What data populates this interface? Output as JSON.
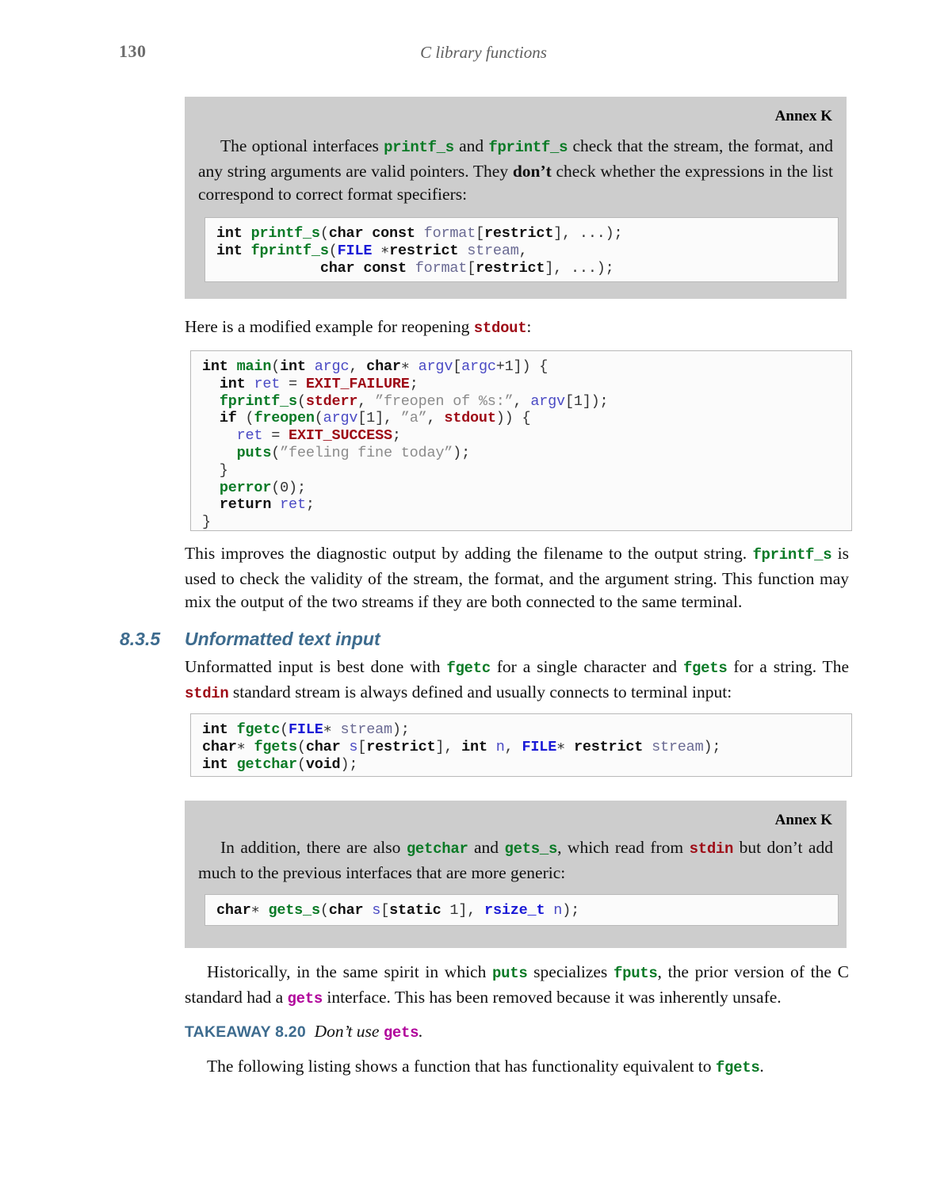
{
  "page": {
    "folio": "130",
    "running_title": "C library functions"
  },
  "annex1": {
    "label": "Annex K",
    "text_parts": [
      {
        "t": "The optional interfaces ",
        "s": "plain"
      },
      {
        "t": "printf_s",
        "s": "func"
      },
      {
        "t": " and ",
        "s": "plain"
      },
      {
        "t": "fprintf_s",
        "s": "func"
      },
      {
        "t": " check that the stream, the for­mat, and any string arguments are valid pointers. They ",
        "s": "plain"
      },
      {
        "t": "don’t",
        "s": "bold"
      },
      {
        "t": " check whether the expres­sions in the list correspond to correct format specifiers:",
        "s": "plain"
      }
    ],
    "code": [
      [
        {
          "t": "int ",
          "c": "kw"
        },
        {
          "t": "printf_s",
          "c": "fn"
        },
        {
          "t": "(",
          "c": "pun"
        },
        {
          "t": "char const",
          "c": "kw"
        },
        {
          "t": " ",
          "c": "pun"
        },
        {
          "t": "format",
          "c": "idg"
        },
        {
          "t": "[",
          "c": "pun"
        },
        {
          "t": "restrict",
          "c": "kw"
        },
        {
          "t": "], ...);",
          "c": "pun"
        }
      ],
      [
        {
          "t": "int ",
          "c": "kw"
        },
        {
          "t": "fprintf_s",
          "c": "fn"
        },
        {
          "t": "(",
          "c": "pun"
        },
        {
          "t": "FILE",
          "c": "ty"
        },
        {
          "t": " ∗",
          "c": "pun"
        },
        {
          "t": "restrict",
          "c": "kw"
        },
        {
          "t": " ",
          "c": "pun"
        },
        {
          "t": "stream",
          "c": "idg"
        },
        {
          "t": ",",
          "c": "pun"
        }
      ],
      [
        {
          "t": "            ",
          "c": "pun"
        },
        {
          "t": "char const",
          "c": "kw"
        },
        {
          "t": " ",
          "c": "pun"
        },
        {
          "t": "format",
          "c": "idg"
        },
        {
          "t": "[",
          "c": "pun"
        },
        {
          "t": "restrict",
          "c": "kw"
        },
        {
          "t": "], ...);",
          "c": "pun"
        }
      ]
    ]
  },
  "lead_in": {
    "parts": [
      {
        "t": "Here is a modified example for reopening ",
        "s": "plain"
      },
      {
        "t": "stdout",
        "s": "macro"
      },
      {
        "t": ":",
        "s": "plain"
      }
    ]
  },
  "main_listing": {
    "code": [
      [
        {
          "t": "int ",
          "c": "kw"
        },
        {
          "t": "main",
          "c": "fn"
        },
        {
          "t": "(",
          "c": "pun"
        },
        {
          "t": "int",
          "c": "kw"
        },
        {
          "t": " ",
          "c": "pun"
        },
        {
          "t": "argc",
          "c": "id"
        },
        {
          "t": ", ",
          "c": "pun"
        },
        {
          "t": "char",
          "c": "kw"
        },
        {
          "t": "∗ ",
          "c": "pun"
        },
        {
          "t": "argv",
          "c": "id"
        },
        {
          "t": "[",
          "c": "pun"
        },
        {
          "t": "argc",
          "c": "id"
        },
        {
          "t": "+1]) {",
          "c": "pun"
        }
      ],
      [
        {
          "t": "  ",
          "c": "pun"
        },
        {
          "t": "int",
          "c": "kw"
        },
        {
          "t": " ",
          "c": "pun"
        },
        {
          "t": "ret",
          "c": "id"
        },
        {
          "t": " = ",
          "c": "pun"
        },
        {
          "t": "EXIT_FAILURE",
          "c": "mac"
        },
        {
          "t": ";",
          "c": "pun"
        }
      ],
      [
        {
          "t": "  ",
          "c": "pun"
        },
        {
          "t": "fprintf_s",
          "c": "fn"
        },
        {
          "t": "(",
          "c": "pun"
        },
        {
          "t": "stderr",
          "c": "mac"
        },
        {
          "t": ", ",
          "c": "pun"
        },
        {
          "t": "”freopen of %s:”",
          "c": "str"
        },
        {
          "t": ", ",
          "c": "pun"
        },
        {
          "t": "argv",
          "c": "id"
        },
        {
          "t": "[1]);",
          "c": "pun"
        }
      ],
      [
        {
          "t": "  ",
          "c": "pun"
        },
        {
          "t": "if",
          "c": "kw"
        },
        {
          "t": " (",
          "c": "pun"
        },
        {
          "t": "freopen",
          "c": "fn"
        },
        {
          "t": "(",
          "c": "pun"
        },
        {
          "t": "argv",
          "c": "id"
        },
        {
          "t": "[1], ",
          "c": "pun"
        },
        {
          "t": "”a”",
          "c": "str"
        },
        {
          "t": ", ",
          "c": "pun"
        },
        {
          "t": "stdout",
          "c": "mac"
        },
        {
          "t": ")) {",
          "c": "pun"
        }
      ],
      [
        {
          "t": "    ",
          "c": "pun"
        },
        {
          "t": "ret",
          "c": "id"
        },
        {
          "t": " = ",
          "c": "pun"
        },
        {
          "t": "EXIT_SUCCESS",
          "c": "mac"
        },
        {
          "t": ";",
          "c": "pun"
        }
      ],
      [
        {
          "t": "    ",
          "c": "pun"
        },
        {
          "t": "puts",
          "c": "fn"
        },
        {
          "t": "(",
          "c": "pun"
        },
        {
          "t": "”feeling fine today”",
          "c": "str"
        },
        {
          "t": ");",
          "c": "pun"
        }
      ],
      [
        {
          "t": "  }",
          "c": "pun"
        }
      ],
      [
        {
          "t": "  ",
          "c": "pun"
        },
        {
          "t": "perror",
          "c": "fn"
        },
        {
          "t": "(0);",
          "c": "pun"
        }
      ],
      [
        {
          "t": "  ",
          "c": "pun"
        },
        {
          "t": "return",
          "c": "kw"
        },
        {
          "t": " ",
          "c": "pun"
        },
        {
          "t": "ret",
          "c": "id"
        },
        {
          "t": ";",
          "c": "pun"
        }
      ],
      [
        {
          "t": "}",
          "c": "pun"
        }
      ]
    ]
  },
  "para_after_listing": {
    "parts": [
      {
        "t": "This improves the diagnostic output by adding the filename to the output string. ",
        "s": "plain"
      },
      {
        "t": "fprintf_s",
        "s": "func"
      },
      {
        "t": " is used to check the validity of the stream, the format, and the argument string. This function may mix the output of the two streams if they are both connected to the same terminal.",
        "s": "plain"
      }
    ]
  },
  "section": {
    "number": "8.3.5",
    "title": "Unformatted text input"
  },
  "section_para": {
    "parts": [
      {
        "t": "Unformatted input is best done with ",
        "s": "plain"
      },
      {
        "t": "fgetc",
        "s": "func"
      },
      {
        "t": " for a single character and ",
        "s": "plain"
      },
      {
        "t": "fgets",
        "s": "func"
      },
      {
        "t": " for a string. The ",
        "s": "plain"
      },
      {
        "t": "stdin",
        "s": "macro"
      },
      {
        "t": " standard stream is always defined and usually connects to terminal input:",
        "s": "plain"
      }
    ]
  },
  "signatures_listing": {
    "code": [
      [
        {
          "t": "int ",
          "c": "kw"
        },
        {
          "t": "fgetc",
          "c": "fn"
        },
        {
          "t": "(",
          "c": "pun"
        },
        {
          "t": "FILE",
          "c": "ty"
        },
        {
          "t": "∗ ",
          "c": "pun"
        },
        {
          "t": "stream",
          "c": "idg"
        },
        {
          "t": ");",
          "c": "pun"
        }
      ],
      [
        {
          "t": "char",
          "c": "kw"
        },
        {
          "t": "∗ ",
          "c": "pun"
        },
        {
          "t": "fgets",
          "c": "fn"
        },
        {
          "t": "(",
          "c": "pun"
        },
        {
          "t": "char",
          "c": "kw"
        },
        {
          "t": " ",
          "c": "pun"
        },
        {
          "t": "s",
          "c": "id"
        },
        {
          "t": "[",
          "c": "pun"
        },
        {
          "t": "restrict",
          "c": "kw"
        },
        {
          "t": "], ",
          "c": "pun"
        },
        {
          "t": "int",
          "c": "kw"
        },
        {
          "t": " ",
          "c": "pun"
        },
        {
          "t": "n",
          "c": "id"
        },
        {
          "t": ", ",
          "c": "pun"
        },
        {
          "t": "FILE",
          "c": "ty"
        },
        {
          "t": "∗ ",
          "c": "pun"
        },
        {
          "t": "restrict",
          "c": "kw"
        },
        {
          "t": " ",
          "c": "pun"
        },
        {
          "t": "stream",
          "c": "idg"
        },
        {
          "t": ");",
          "c": "pun"
        }
      ],
      [
        {
          "t": "int ",
          "c": "kw"
        },
        {
          "t": "getchar",
          "c": "fn"
        },
        {
          "t": "(",
          "c": "pun"
        },
        {
          "t": "void",
          "c": "kw"
        },
        {
          "t": ");",
          "c": "pun"
        }
      ]
    ]
  },
  "annex2": {
    "label": "Annex K",
    "text_parts": [
      {
        "t": "In addition, there are also ",
        "s": "plain"
      },
      {
        "t": "getchar",
        "s": "func"
      },
      {
        "t": " and ",
        "s": "plain"
      },
      {
        "t": "gets_s",
        "s": "func"
      },
      {
        "t": ", which read  from ",
        "s": "plain"
      },
      {
        "t": "stdin",
        "s": "macro"
      },
      {
        "t": " but don’t add much to the previous interfaces that are more generic:",
        "s": "plain"
      }
    ],
    "code": [
      [
        {
          "t": "char",
          "c": "kw"
        },
        {
          "t": "∗ ",
          "c": "pun"
        },
        {
          "t": "gets_s",
          "c": "fn"
        },
        {
          "t": "(",
          "c": "pun"
        },
        {
          "t": "char",
          "c": "kw"
        },
        {
          "t": " ",
          "c": "pun"
        },
        {
          "t": "s",
          "c": "id"
        },
        {
          "t": "[",
          "c": "pun"
        },
        {
          "t": "static",
          "c": "kw"
        },
        {
          "t": " 1], ",
          "c": "pun"
        },
        {
          "t": "rsize_t",
          "c": "ty"
        },
        {
          "t": " ",
          "c": "pun"
        },
        {
          "t": "n",
          "c": "id"
        },
        {
          "t": ");",
          "c": "pun"
        }
      ]
    ]
  },
  "historical_para": {
    "parts": [
      {
        "t": "Historically, in the same spirit in which ",
        "s": "plain"
      },
      {
        "t": "puts",
        "s": "func"
      },
      {
        "t": " specializes ",
        "s": "plain"
      },
      {
        "t": "fputs",
        "s": "func"
      },
      {
        "t": ", the prior version of the C standard had a ",
        "s": "plain"
      },
      {
        "t": "gets",
        "s": "gets"
      },
      {
        "t": " interface. This has been removed because it was inherently unsafe.",
        "s": "plain"
      }
    ]
  },
  "takeaway": {
    "label": "TAKEAWAY 8.20",
    "text_before": "Don’t use ",
    "code": "gets",
    "text_after": "."
  },
  "closing_para": {
    "parts": [
      {
        "t": "The following listing shows a function that has functionality equivalent to ",
        "s": "plain"
      },
      {
        "t": "fgets",
        "s": "func"
      },
      {
        "t": ".",
        "s": "plain"
      }
    ]
  },
  "colors": {
    "panel_gray": "#cdcdcd",
    "code_bg": "#fbfbfb",
    "code_border": "#b9b9b9",
    "accent_blue": "#3d6b8e",
    "func_green": "#0a7a26",
    "macro_red": "#9e0b16",
    "gets_magenta": "#b0009a",
    "type_blue": "#1a1ad6",
    "head_gray": "#5e5e5e"
  }
}
